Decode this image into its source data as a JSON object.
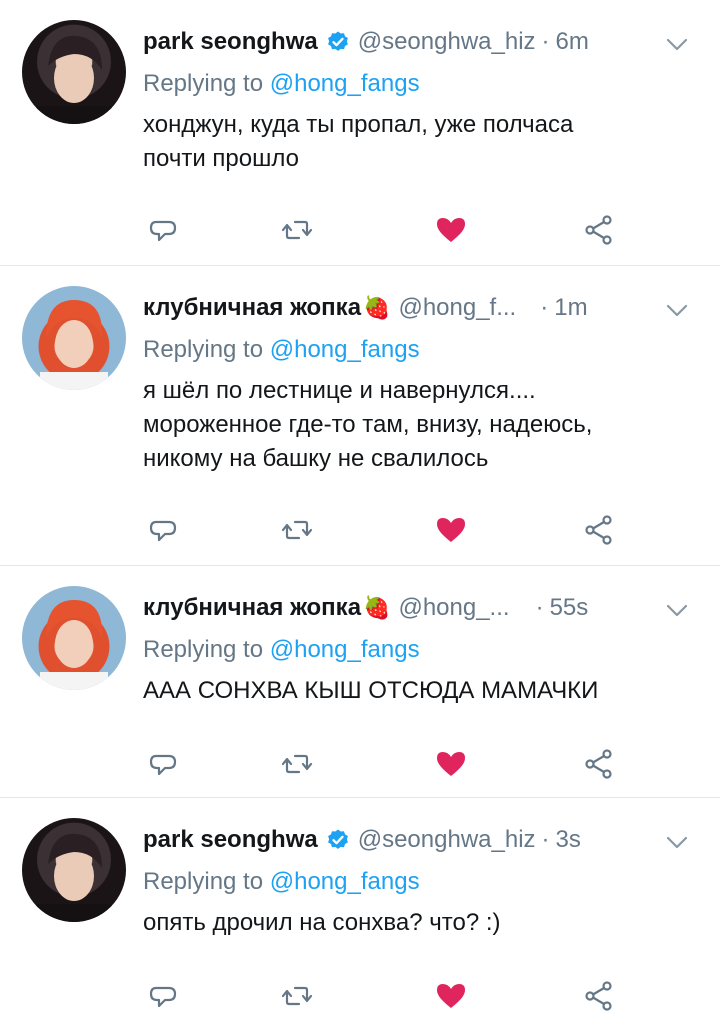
{
  "tweets": [
    {
      "author": "park seonghwa",
      "emoji": "",
      "verified": true,
      "handle": "@seonghwa_hiz",
      "time": "6m",
      "reply_label": "Replying to",
      "reply_to": "@hong_fangs",
      "text_lines": [
        "хонджун, куда ты пропал, уже полчаса",
        "почти прошло"
      ],
      "liked": true
    },
    {
      "author": "клубничная жопка",
      "emoji": "🍓",
      "verified": false,
      "handle": "@hong_f...",
      "time": "1m",
      "reply_label": "Replying to",
      "reply_to": "@hong_fangs",
      "text_lines": [
        "я шёл по лестнице и навернулся....",
        "мороженное где-то там, внизу, надеюсь,",
        "никому на башку не свалилось"
      ],
      "liked": true
    },
    {
      "author": "клубничная жопка",
      "emoji": "🍓",
      "verified": false,
      "handle": "@hong_...",
      "time": "55s",
      "reply_label": "Replying to",
      "reply_to": "@hong_fangs",
      "text_lines": [
        "ААА СОНХВА КЫШ ОТСЮДА МАМАЧКИ"
      ],
      "liked": true
    },
    {
      "author": "park seonghwa",
      "emoji": "",
      "verified": true,
      "handle": "@seonghwa_hiz",
      "time": "3s",
      "reply_label": "Replying to",
      "reply_to": "@hong_fangs",
      "text_lines": [
        "опять дрочил на сонхва? что? :)"
      ],
      "liked": true
    }
  ],
  "icons": {
    "reply": "reply-icon",
    "retweet": "retweet-icon",
    "like": "heart-icon",
    "share": "share-icon",
    "more": "chevron-down-icon",
    "verified": "verified-badge-icon"
  },
  "colors": {
    "like": "#e0245e",
    "mention": "#1da1f2",
    "secondary_text": "#657786",
    "verified": "#1da1f2"
  }
}
